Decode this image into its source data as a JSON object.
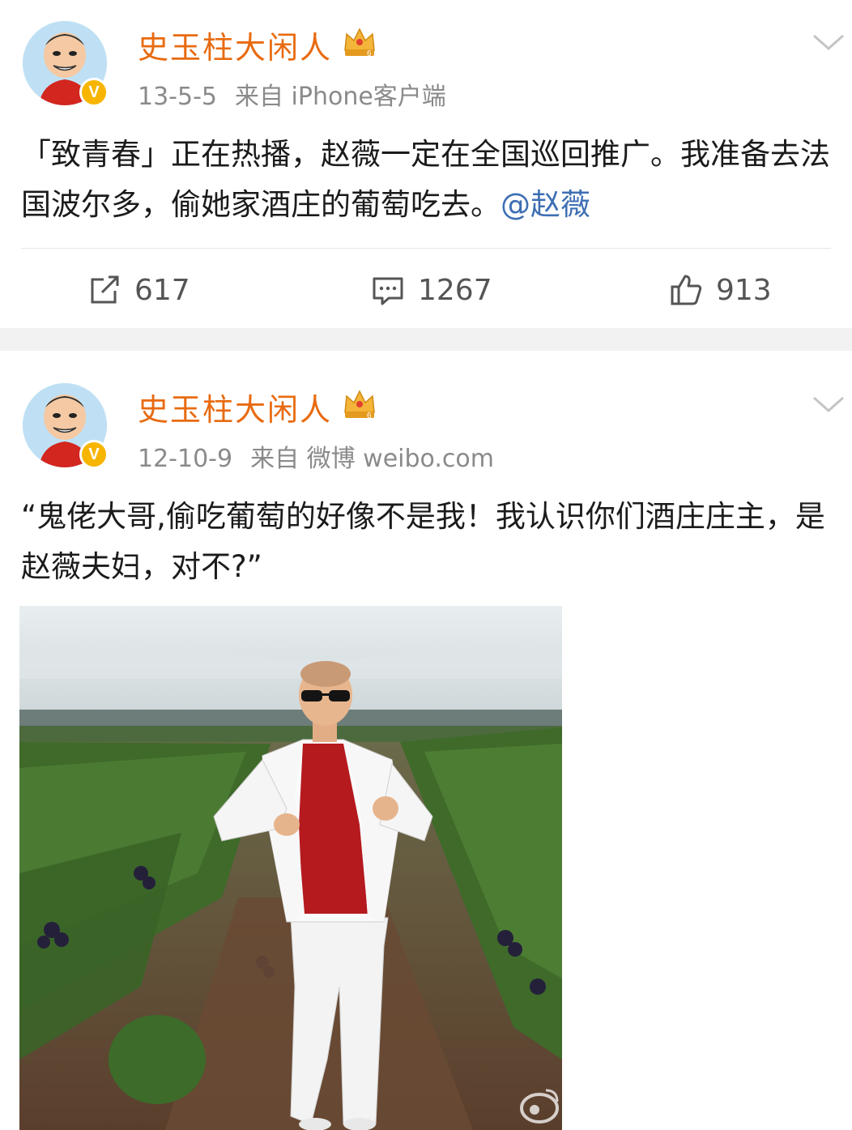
{
  "posts": [
    {
      "username": "史玉柱大闲人",
      "date": "13-5-5",
      "source": "来自 iPhone客户端",
      "text_main": "「致青春」正在热播，赵薇一定在全国巡回推广。我准备去法国波尔多，偷她家酒庄的葡萄吃去。",
      "mention": "@赵薇",
      "actions": {
        "repost": "617",
        "comment": "1267",
        "like": "913"
      }
    },
    {
      "username": "史玉柱大闲人",
      "date": "12-10-9",
      "source": "来自 微博 weibo.com",
      "text_main": "“鬼佬大哥,偷吃葡萄的好像不是我！我认识你们酒庄庄主，是赵薇夫妇，对不?”",
      "image_watermark": "weibo-logo"
    }
  ],
  "icons": {
    "verified": "verified-badge-icon",
    "crown": "crown-level-icon",
    "more": "chevron-down-icon",
    "repost": "repost-icon",
    "comment": "comment-icon",
    "like": "thumbs-up-icon"
  },
  "colors": {
    "username": "#e86b10",
    "mention": "#3d6fb3",
    "meta": "#8a8a8a",
    "separator": "#f2f2f2",
    "verified": "#f7b500"
  }
}
